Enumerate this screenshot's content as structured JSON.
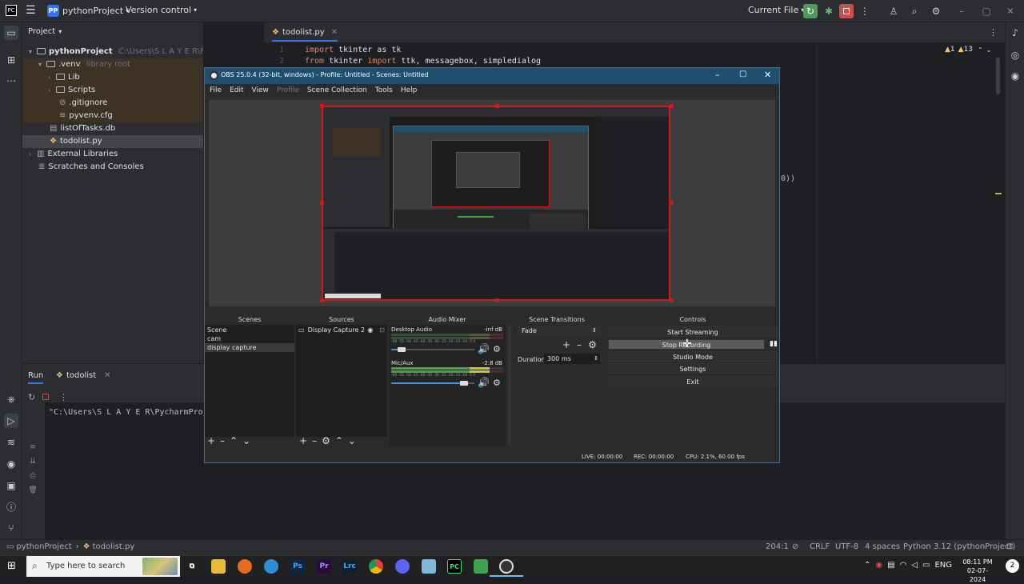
{
  "pycharm": {
    "project_badge": "PP",
    "project_name": "pythonProject",
    "vcs": "Version control",
    "run_config": "Current File",
    "project_label": "Project",
    "tree": {
      "root": "pythonProject",
      "root_path": "C:\\Users\\S L A Y E R\\PycharmProjects\\pythonProject",
      "venv": ".venv",
      "venv_hint": "library root",
      "items": [
        "Lib",
        "Scripts",
        ".gitignore",
        "pyvenv.cfg",
        "listOfTasks.db",
        "todolist.py",
        "External Libraries",
        "Scratches and Consoles"
      ]
    },
    "tab": "todolist.py",
    "code": {
      "line1": "1",
      "line2": "2",
      "import_kw": "import",
      "line1_rest": " tkinter as tk",
      "from_kw": "from",
      "line2_mid": " tkinter ",
      "line2_rest": " ttk, messagebox, simpledialog",
      "fragment": "0))"
    },
    "inspections": {
      "warnings": "1",
      "weak": "13"
    },
    "run": {
      "label": "Run",
      "config": "todolist",
      "console_text": "\"C:\\Users\\S L A Y E R\\PycharmProjects"
    },
    "status": {
      "breadcrumb_project": "pythonProject",
      "breadcrumb_file": "todolist.py",
      "position": "204:1",
      "line_sep": "CRLF",
      "encoding": "UTF-8",
      "indent": "4 spaces",
      "interpreter": "Python 3.12 (pythonProject)"
    }
  },
  "obs": {
    "title": "OBS 25.0.4 (32-bit, windows) - Profile: Untitled - Scenes: Untitled",
    "menu": [
      "File",
      "Edit",
      "View",
      "Profile",
      "Scene Collection",
      "Tools",
      "Help"
    ],
    "docks": {
      "scenes": "Scenes",
      "sources": "Sources",
      "mixer": "Audio Mixer",
      "transitions": "Scene Transitions",
      "controls": "Controls"
    },
    "scenes": [
      "Scene",
      "cam",
      "display capture"
    ],
    "sources": [
      "Display Capture 2"
    ],
    "mixer": [
      {
        "name": "Desktop Audio",
        "level": "-inf dB",
        "volume": 0.08
      },
      {
        "name": "Mic/Aux",
        "level": "-2.8 dB",
        "volume": 0.92
      }
    ],
    "meter_scale": "-60 -55 -50 -45 -40 -35 -30 -25 -20 -15 -10 -5 0",
    "transition": "Fade",
    "duration_label": "Duration",
    "duration_value": "300 ms",
    "controls": [
      "Start Streaming",
      "Stop Recording",
      "Studio Mode",
      "Settings",
      "Exit"
    ],
    "stats": {
      "live": "LIVE: 00:00:00",
      "rec": "REC: 00:00:00",
      "cpu": "CPU: 2.1%, 60.00 fps"
    }
  },
  "taskbar": {
    "search_placeholder": "Type here to search",
    "lang": "ENG",
    "time": "08:11 PM",
    "date": "02-07-2024",
    "app_labels": [
      "Ps",
      "Pr",
      "Lrc"
    ]
  },
  "colors": {
    "accent": "#3574f0",
    "record_red": "#d01a1a",
    "obs_title": "#1f4f6e"
  }
}
